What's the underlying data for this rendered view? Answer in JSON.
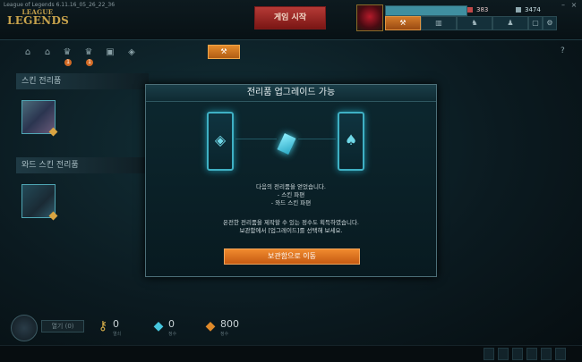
{
  "window": {
    "title": "League of Legends 6.11.16_05_26_22_36"
  },
  "logo": {
    "line1": "LEAGUE",
    "line2": "LEGENDS"
  },
  "header": {
    "play_button": "게임 시작",
    "rp": "383",
    "ip": "3474"
  },
  "toolbar": {
    "badges": [
      "1",
      "1"
    ]
  },
  "inventory": {
    "skin_shards_header": "스킨 전리품",
    "ward_shards_header": "와드 스킨 전리품"
  },
  "modal": {
    "title": "전리품 업그레이드 가능",
    "obtained_line": "다음의 전리품을 얻었습니다.",
    "item1": "- 스킨 파편",
    "item2": "- 와드 스킨 파편",
    "info_line1": "온전한 전리품을 제작할 수 있는 정수도 획득하였습니다.",
    "info_line2": "보관함에서 [업그레이드]를 선택해 보세요.",
    "button": "보관함으로 이동"
  },
  "bottom": {
    "open_button": "열기 (0)",
    "keys": {
      "value": "0",
      "label": "열쇠"
    },
    "blue_essence": {
      "value": "0",
      "label": "정수"
    },
    "orange_essence": {
      "value": "800",
      "label": "정수"
    }
  },
  "colors": {
    "accent_orange": "#e07a28",
    "teal": "#3fb0c4",
    "play_red": "#b53a36",
    "rp_red": "#c24848"
  }
}
